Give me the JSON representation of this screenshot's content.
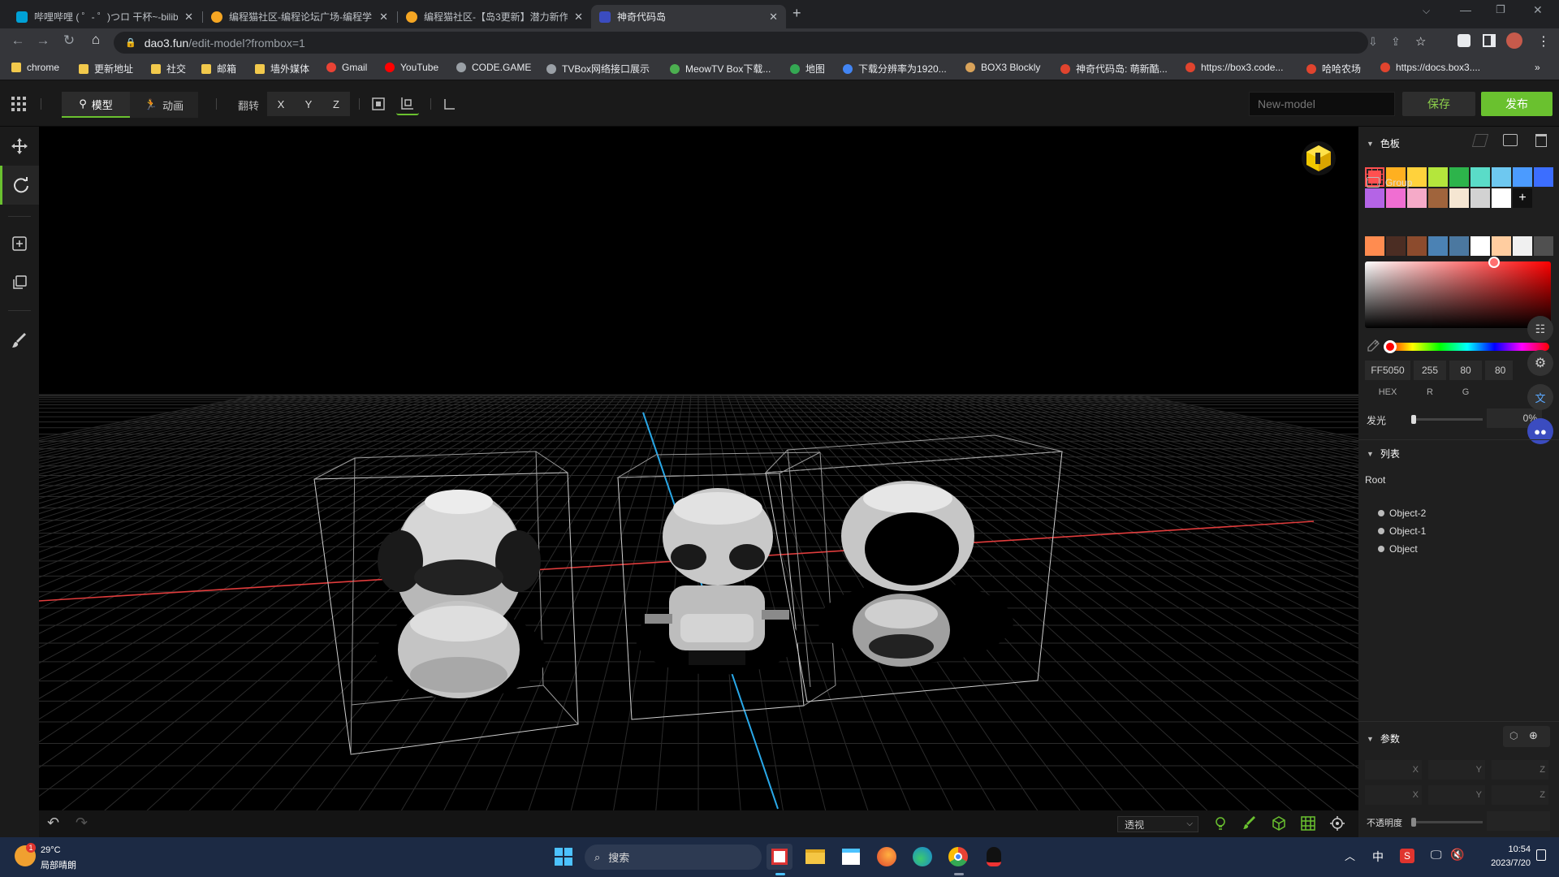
{
  "browser": {
    "tabs": [
      {
        "title": "哔哩哔哩 ( ゜- ゜)つロ 干杯~-bilibili",
        "icon": "bilibili-icon",
        "active": false
      },
      {
        "title": "编程猫社区-编程论坛广场-编程学习",
        "icon": "codemao-icon",
        "active": false
      },
      {
        "title": "编程猫社区-【岛3更新】潜力新作",
        "icon": "codemao-icon",
        "active": false
      },
      {
        "title": "神奇代码岛",
        "icon": "dao3-icon",
        "active": true
      }
    ],
    "url_host": "dao3.fun",
    "url_path": "/edit-model?frombox=1",
    "bookmarks": [
      {
        "label": "chrome",
        "icon": "folder-icon"
      },
      {
        "label": "更新地址",
        "icon": "folder-icon"
      },
      {
        "label": "社交",
        "icon": "folder-icon"
      },
      {
        "label": "邮箱",
        "icon": "folder-icon"
      },
      {
        "label": "墙外媒体",
        "icon": "folder-icon"
      },
      {
        "label": "Gmail",
        "icon": "gmail-icon"
      },
      {
        "label": "YouTube",
        "icon": "youtube-icon"
      },
      {
        "label": "CODE.GAME",
        "icon": "globe-icon"
      },
      {
        "label": "TVBox网络接口展示",
        "icon": "globe-icon"
      },
      {
        "label": "MeowTV Box下载...",
        "icon": "pinwheel-icon"
      },
      {
        "label": "地图",
        "icon": "map-pin-icon"
      },
      {
        "label": "下载分辨率为1920...",
        "icon": "image-icon"
      },
      {
        "label": "BOX3 Blockly",
        "icon": "box3-icon"
      },
      {
        "label": "神奇代码岛: 萌新酷...",
        "icon": "dao3-icon"
      },
      {
        "label": "https://box3.code...",
        "icon": "dao3-icon"
      },
      {
        "label": "哈哈农场",
        "icon": "dao3-icon"
      },
      {
        "label": "https://docs.box3....",
        "icon": "dao3-icon"
      }
    ]
  },
  "toolbar": {
    "mode_model": "模型",
    "mode_anim": "动画",
    "flip_label": "翻转",
    "axis_x": "X",
    "axis_y": "Y",
    "axis_z": "Z",
    "model_name_placeholder": "New-model",
    "save_label": "保存",
    "publish_label": "发布"
  },
  "viewport": {
    "view_mode": "透视"
  },
  "palette": {
    "title": "色板",
    "swatches_row1": [
      "#ff5050",
      "#ffb020",
      "#ffd23c",
      "#b4e63c",
      "#2db44b",
      "#5adcc8",
      "#6ec8f0",
      "#4b9bff",
      "#3c6eff"
    ],
    "swatches_row2": [
      "#b464e6",
      "#f06ed2",
      "#f5aac8",
      "#a0643c",
      "#f5e6d2",
      "#d2d2d2",
      "#ffffff"
    ],
    "add_label": "+",
    "group_label": "Group",
    "group_swatches": [
      "#ff8c50",
      "#4b2d23",
      "#8c4b2d",
      "#4b82b4",
      "#4b78a0",
      "#ffffff",
      "#ffcda0",
      "#f0f0f0",
      "#505050"
    ],
    "hex_value": "FF5050",
    "r_value": "255",
    "g_value": "80",
    "b_value": "80",
    "hex_label": "HEX",
    "r_label": "R",
    "g_label": "G",
    "glow_label": "发光",
    "glow_value": "0%",
    "hue_position": 0.0
  },
  "list": {
    "title": "列表",
    "root": "Root",
    "items": [
      "Object-2",
      "Object-1",
      "Object"
    ]
  },
  "params": {
    "title": "参数",
    "x_label": "X",
    "y_label": "Y",
    "z_label": "Z",
    "opacity_label": "不透明度"
  },
  "taskbar": {
    "weather_temp": "29°C",
    "weather_desc": "局部晴朗",
    "weather_badge": "1",
    "search_label": "搜索",
    "ime": "中",
    "time": "10:54",
    "date": "2023/7/20"
  }
}
